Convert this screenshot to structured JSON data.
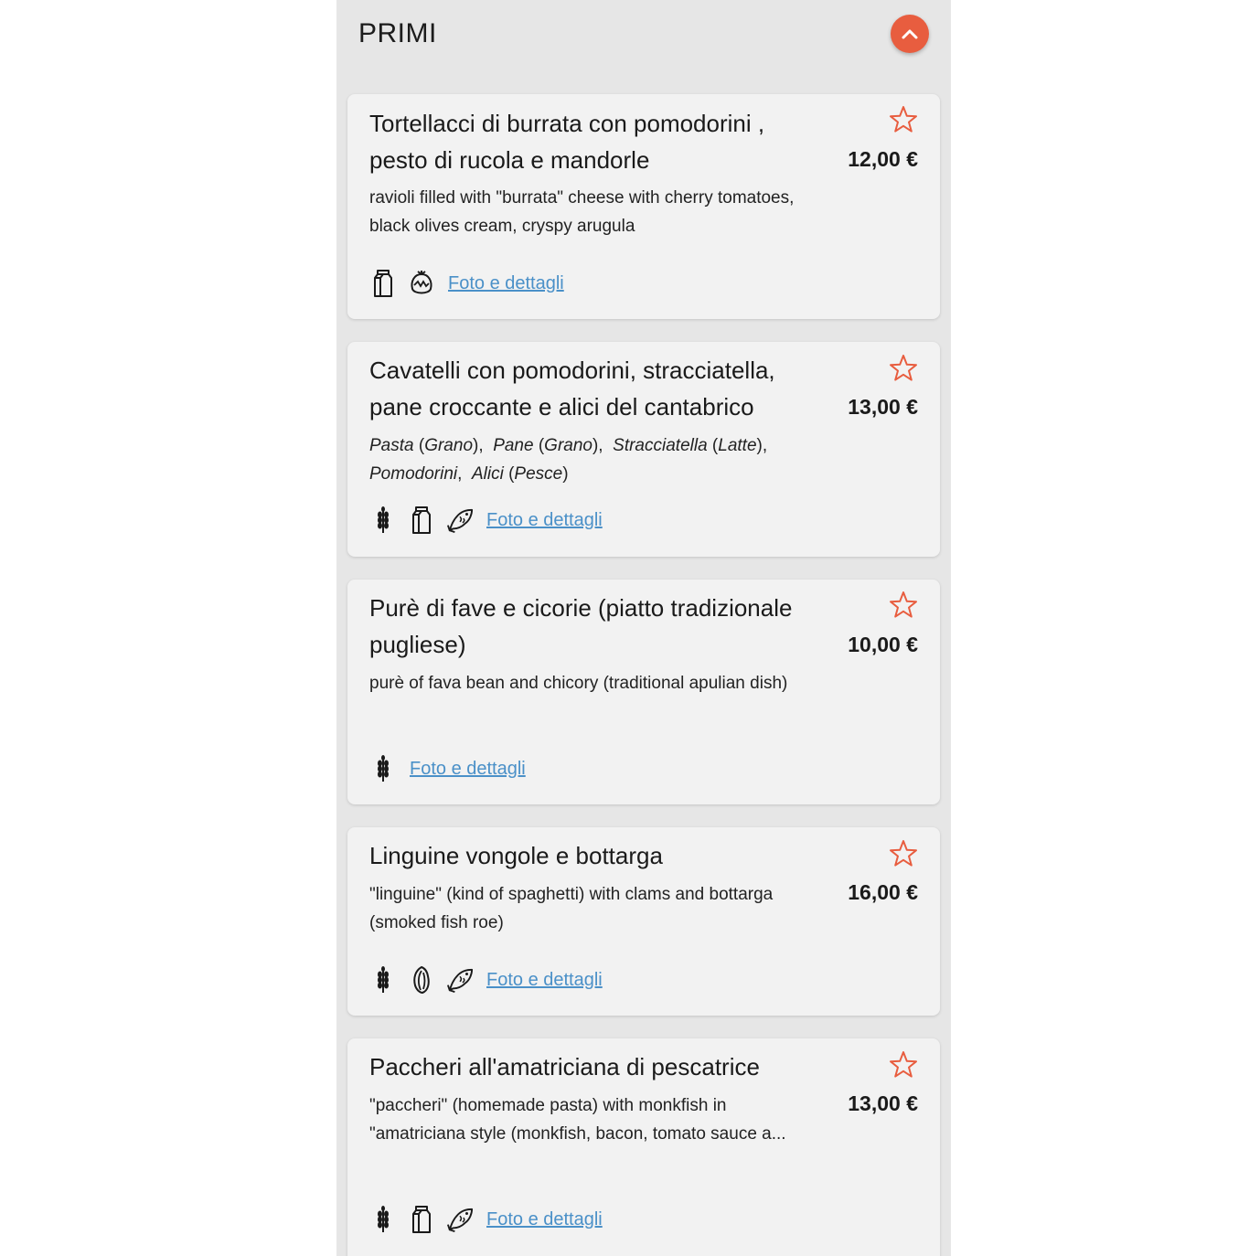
{
  "section": {
    "title": "PRIMI"
  },
  "colors": {
    "accent": "#e85d3f",
    "link": "#4a90c8"
  },
  "dishes": [
    {
      "title": "Tortellacci di burrata con pomodorini , pesto di rucola e mandorle",
      "description": "ravioli filled with \"burrata\" cheese with cherry tomatoes, black olives cream, cryspy arugula",
      "price": "12,00 €",
      "allergens": [
        "milk-icon",
        "nuts-icon"
      ],
      "details_link": "Foto e dettagli"
    },
    {
      "title": "Cavatelli con pomodorini, stracciatella, pane croccante e alici del cantabrico",
      "ingredients": [
        {
          "name": "Pasta",
          "allergen": "Grano"
        },
        {
          "name": "Pane",
          "allergen": "Grano"
        },
        {
          "name": "Stracciatella",
          "allergen": "Latte"
        },
        {
          "name": "Pomodorini",
          "allergen": ""
        },
        {
          "name": "Alici",
          "allergen": "Pesce"
        }
      ],
      "price": "13,00 €",
      "allergens": [
        "wheat-icon",
        "milk-icon",
        "fish-icon"
      ],
      "details_link": "Foto e dettagli"
    },
    {
      "title": "Purè di fave e cicorie (piatto tradizionale pugliese)",
      "description": "purè of fava bean and chicory (traditional apulian dish)",
      "price": "10,00 €",
      "allergens": [
        "wheat-icon"
      ],
      "details_link": "Foto e dettagli"
    },
    {
      "title": "Linguine vongole e bottarga",
      "description": "\"linguine\" (kind of spaghetti) with clams and bottarga (smoked fish roe)",
      "price": "16,00 €",
      "allergens": [
        "wheat-icon",
        "mollusc-icon",
        "fish-icon"
      ],
      "details_link": "Foto e dettagli"
    },
    {
      "title": "Paccheri all'amatriciana di pescatrice",
      "description": "\"paccheri\" (homemade pasta) with monkfish in \"amatriciana style (monkfish, bacon, tomato sauce a...",
      "price": "13,00 €",
      "allergens": [
        "wheat-icon",
        "milk-icon",
        "fish-icon"
      ],
      "details_link": "Foto e dettagli"
    }
  ]
}
